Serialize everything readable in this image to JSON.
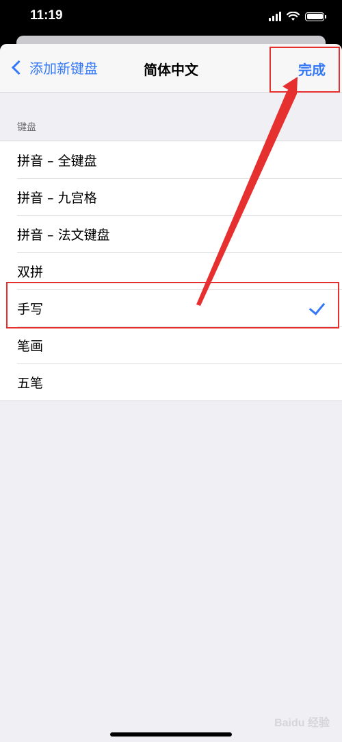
{
  "status_bar": {
    "time": "11:19"
  },
  "nav": {
    "back_label": "添加新键盘",
    "title": "简体中文",
    "done_label": "完成"
  },
  "section": {
    "header": "键盘"
  },
  "keyboards": [
    {
      "label": "拼音 – 全键盘",
      "checked": false
    },
    {
      "label": "拼音 – 九宫格",
      "checked": false
    },
    {
      "label": "拼音 – 法文键盘",
      "checked": false
    },
    {
      "label": "双拼",
      "checked": false
    },
    {
      "label": "手写",
      "checked": true
    },
    {
      "label": "笔画",
      "checked": false
    },
    {
      "label": "五笔",
      "checked": false
    }
  ],
  "colors": {
    "accent": "#3478f6",
    "annotation": "#e62f2f",
    "background": "#efeff4"
  },
  "watermark": "Baidu 经验"
}
